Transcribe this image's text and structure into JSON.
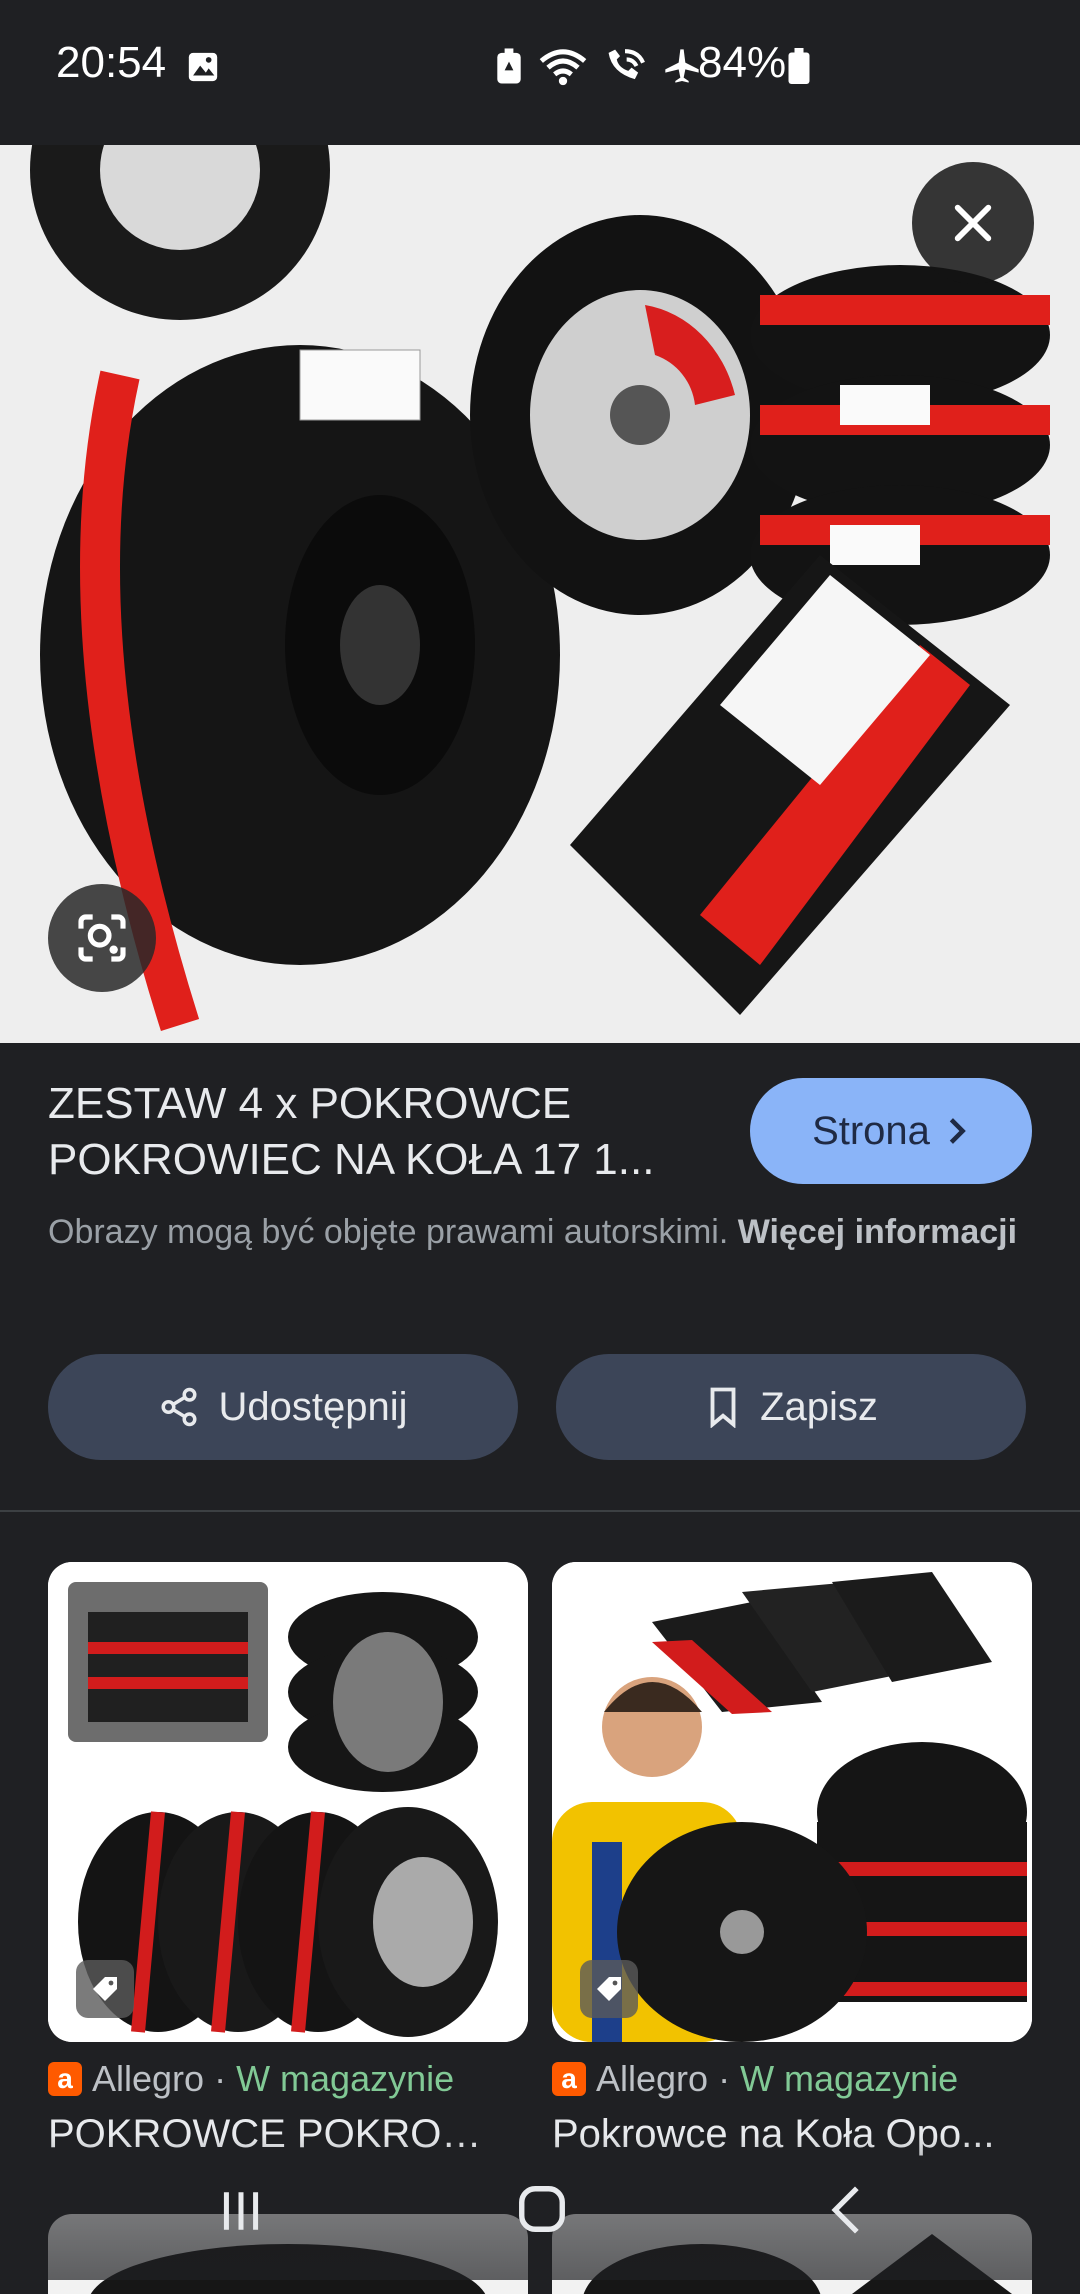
{
  "status_bar": {
    "time": "20:54",
    "battery": "84%",
    "icons": [
      "image-icon",
      "battery-saver-icon",
      "wifi-icon",
      "wifi-call-icon",
      "airplane-icon",
      "battery-icon"
    ]
  },
  "viewer": {
    "close_icon": "close-icon",
    "lens_icon": "lens-icon",
    "title_line1": "ZESTAW 4 x POKROWCE",
    "title_line2": "POKROWIEC NA KOŁA 17 1...",
    "visit_label": "Strona",
    "copyright_text": "Obrazy mogą być objęte prawami autorskimi.",
    "copyright_link": "Więcej informacji",
    "share_label": "Udostępnij",
    "save_label": "Zapisz"
  },
  "related": [
    {
      "source": "Allegro",
      "availability": "W magazynie",
      "title": "POKROWCE POKROWI..."
    },
    {
      "source": "Allegro",
      "availability": "W magazynie",
      "title": "Pokrowce na Koła Opo..."
    }
  ],
  "colors": {
    "accent": "#8ab4f8",
    "background": "#1f2023",
    "pill": "#3c4558",
    "stock": "#81c995",
    "allegro": "#ff5a00"
  }
}
